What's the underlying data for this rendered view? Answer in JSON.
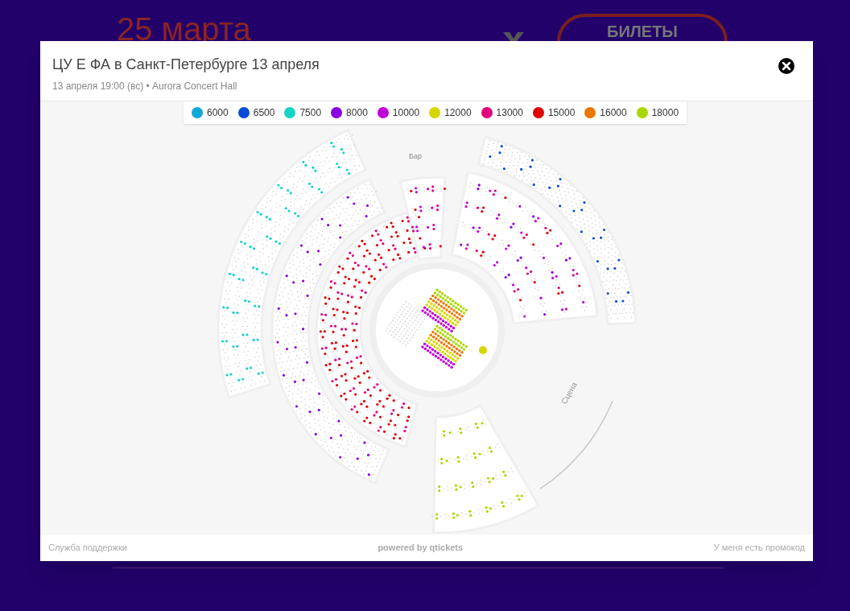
{
  "background": {
    "date": "25 марта",
    "tickets_button": "БИЛЕТЫ"
  },
  "modal": {
    "title": "ЦУ Е ФА в Санкт-Петербурге 13 апреля",
    "subtitle": "13 апреля 19:00 (вс) • Aurora Concert Hall"
  },
  "legend": [
    {
      "price": "6000",
      "color": "#0fa8d8"
    },
    {
      "price": "6500",
      "color": "#0a4bd8"
    },
    {
      "price": "7500",
      "color": "#14d4c8"
    },
    {
      "price": "8000",
      "color": "#8a00e0"
    },
    {
      "price": "10000",
      "color": "#c000d8"
    },
    {
      "price": "12000",
      "color": "#d6d600"
    },
    {
      "price": "13000",
      "color": "#e0007a"
    },
    {
      "price": "15000",
      "color": "#e00000"
    },
    {
      "price": "16000",
      "color": "#e87800"
    },
    {
      "price": "18000",
      "color": "#a8d800"
    }
  ],
  "map_labels": {
    "bar": "Бар",
    "stage": "Сцена"
  },
  "footer": {
    "support": "Служба поддержки",
    "powered": "powered by qtickets",
    "promo": "У меня есть промокод"
  }
}
